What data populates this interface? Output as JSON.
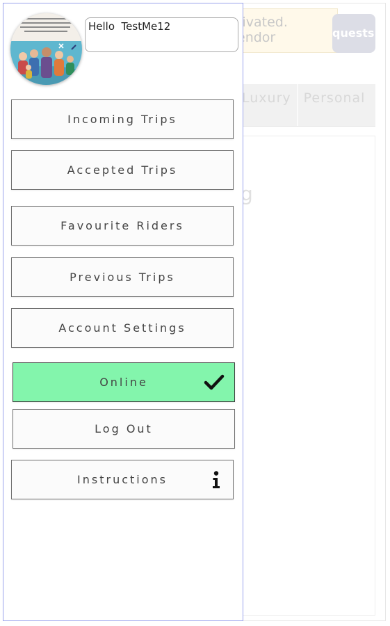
{
  "app": {
    "background": {
      "notice_lines": [
        "tivated.",
        "endor"
      ],
      "requests_label": "quests",
      "tabs": [
        "Luxury",
        "Personal"
      ],
      "content_fragment": "g"
    },
    "drawer": {
      "greeting": "Hello  TestMe12",
      "avatar_icon": "family-group-avatar",
      "menu": [
        {
          "label": "Incoming Trips"
        },
        {
          "label": "Accepted Trips"
        },
        {
          "label": "Favourite Riders"
        },
        {
          "label": "Previous Trips"
        },
        {
          "label": "Account Settings"
        }
      ],
      "online": {
        "label": "Online",
        "icon": "checkmark-icon",
        "color": "#83f5ac"
      },
      "logout": {
        "label": "Log Out"
      },
      "instructions": {
        "label": "Instructions",
        "icon": "info-icon"
      }
    }
  },
  "colors": {
    "drawer_border": "#9aa3ec",
    "online_green": "#83f5ac",
    "button_border": "#6e6e6e"
  }
}
